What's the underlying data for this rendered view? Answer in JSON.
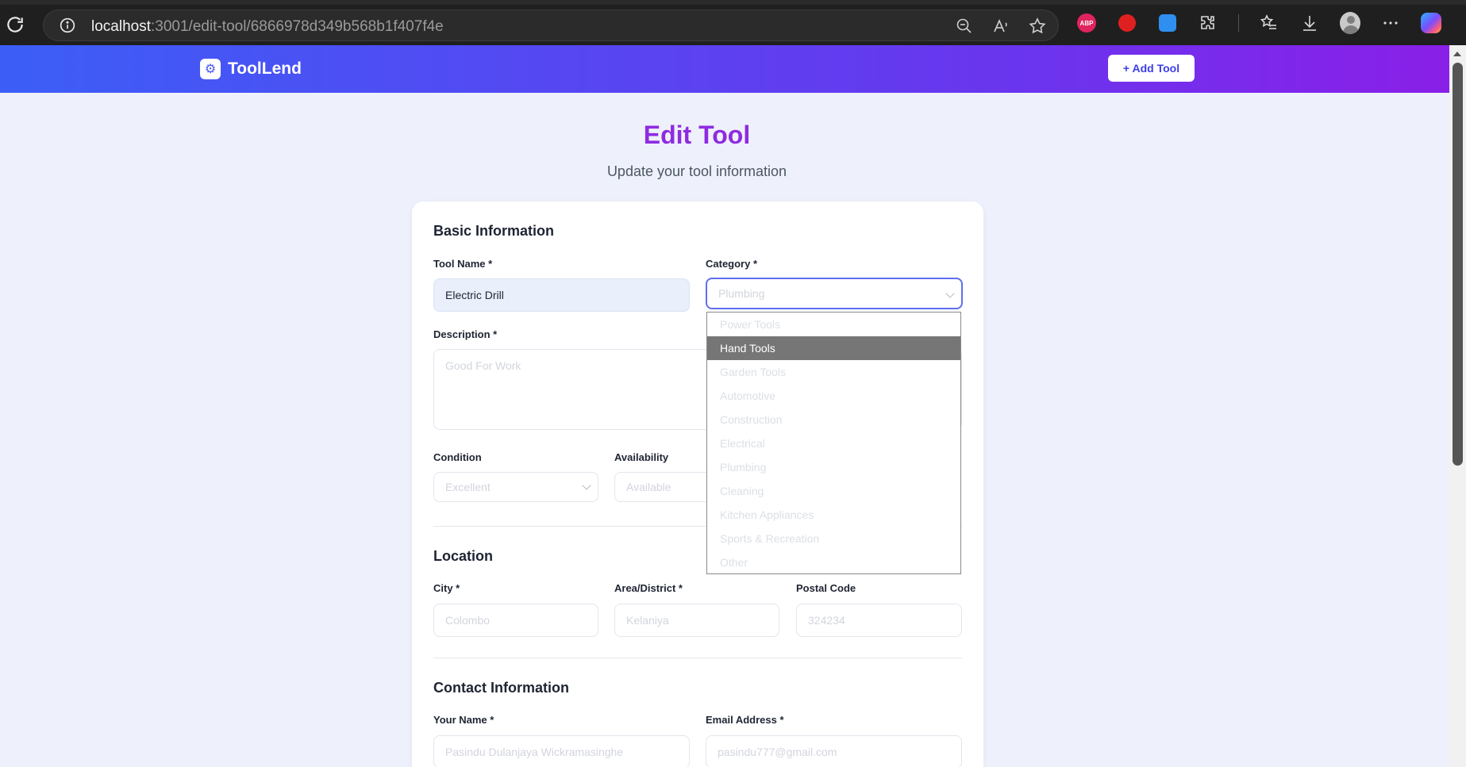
{
  "browser": {
    "url_host": "localhost",
    "url_path": ":3001/edit-tool/6866978d349b568b1f407f4e",
    "extension_abp_label": "ABP"
  },
  "header": {
    "brand": "ToolLend",
    "add_tool_label": "+ Add Tool"
  },
  "page": {
    "title": "Edit Tool",
    "subtitle": "Update your tool information"
  },
  "basic": {
    "section_title": "Basic Information",
    "tool_name_label": "Tool Name *",
    "tool_name_value": "Electric Drill",
    "category_label": "Category *",
    "category_value": "Plumbing",
    "description_label": "Description *",
    "description_placeholder": "Good For Work",
    "condition_label": "Condition",
    "condition_value": "Excellent",
    "availability_label": "Availability",
    "availability_value": "Available"
  },
  "category_options": [
    {
      "label": "Power Tools"
    },
    {
      "label": "Hand Tools"
    },
    {
      "label": "Garden Tools"
    },
    {
      "label": "Automotive"
    },
    {
      "label": "Construction"
    },
    {
      "label": "Electrical"
    },
    {
      "label": "Plumbing"
    },
    {
      "label": "Cleaning"
    },
    {
      "label": "Kitchen Appliances"
    },
    {
      "label": "Sports & Recreation"
    },
    {
      "label": "Other"
    }
  ],
  "category_highlighted": "Hand Tools",
  "location": {
    "section_title": "Location",
    "city_label": "City *",
    "city_value": "Colombo",
    "area_label": "Area/District *",
    "area_value": "Kelaniya",
    "postal_label": "Postal Code",
    "postal_value": "324234"
  },
  "contact": {
    "section_title": "Contact Information",
    "name_label": "Your Name *",
    "name_value": "Pasindu Dulanjaya Wickramasinghe",
    "email_label": "Email Address *",
    "email_value": "pasindu777@gmail.com"
  }
}
